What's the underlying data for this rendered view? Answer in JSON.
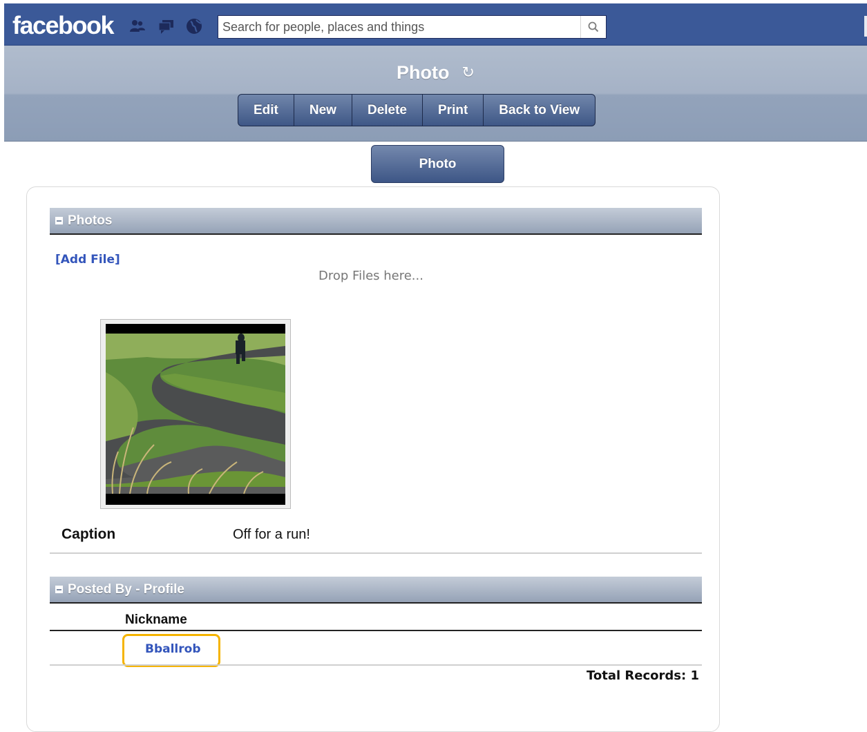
{
  "facebook_bar": {
    "logo": "facebook",
    "jewels": [
      "friends-icon",
      "messages-icon",
      "notifications-globe-icon"
    ],
    "search": {
      "placeholder": "Search for people, places and things",
      "value": ""
    },
    "search_icon": "magnifier-icon",
    "colors": {
      "bar": "#3b5998"
    }
  },
  "page": {
    "title": "Photo",
    "refresh_icon": "↻"
  },
  "toolbar": {
    "edit_label": "Edit",
    "new_label": "New",
    "delete_label": "Delete",
    "print_label": "Print",
    "back_label": "Back to View"
  },
  "tabs": {
    "active_label": "Photo"
  },
  "photos_section": {
    "header": "Photos",
    "add_file": "[Add File]",
    "drop_hint": "Drop Files here...",
    "caption_label": "Caption",
    "caption_value": "Off for a run!"
  },
  "posted_by_section": {
    "header": "Posted By - Profile",
    "column_header": "Nickname",
    "rows": [
      {
        "nickname": "Bballrob"
      }
    ],
    "total_records": "Total Records: 1",
    "highlight_color": "#f5b400"
  }
}
